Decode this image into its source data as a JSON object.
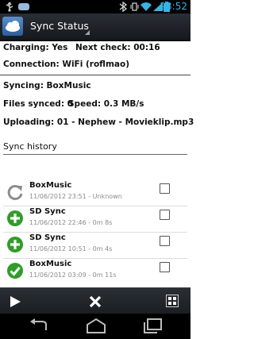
{
  "status_bar": {
    "time": "23:52"
  },
  "header": {
    "title": "Sync Status"
  },
  "info": {
    "charging": "Charging: Yes",
    "next_check": "Next check: 00:16",
    "connection": "Connection: WiFi (roflmao)",
    "syncing": "Syncing: BoxMusic",
    "files_synced": "Files synced: 0",
    "speed": "Speed: 0.3 MB/s",
    "uploading": "Uploading: 01 - Nephew - Movieklip.mp3"
  },
  "history": {
    "title": "Sync history",
    "items": [
      {
        "name": "BoxMusic",
        "detail": "11/06/2012 23:51 - Unknown",
        "icon": "refresh-icon"
      },
      {
        "name": "SD Sync",
        "detail": "11/06/2012 22:46 - 0m 8s",
        "icon": "plus-icon"
      },
      {
        "name": "SD Sync",
        "detail": "11/06/2012 10:51 - 0m 4s",
        "icon": "plus-icon"
      },
      {
        "name": "BoxMusic",
        "detail": "11/06/2012 03:09 - 0m 11s",
        "icon": "checkmark-icon"
      }
    ]
  },
  "colors": {
    "accent": "#33b5e5",
    "green": "#2e9e27",
    "actionbar": "#1f2429"
  }
}
